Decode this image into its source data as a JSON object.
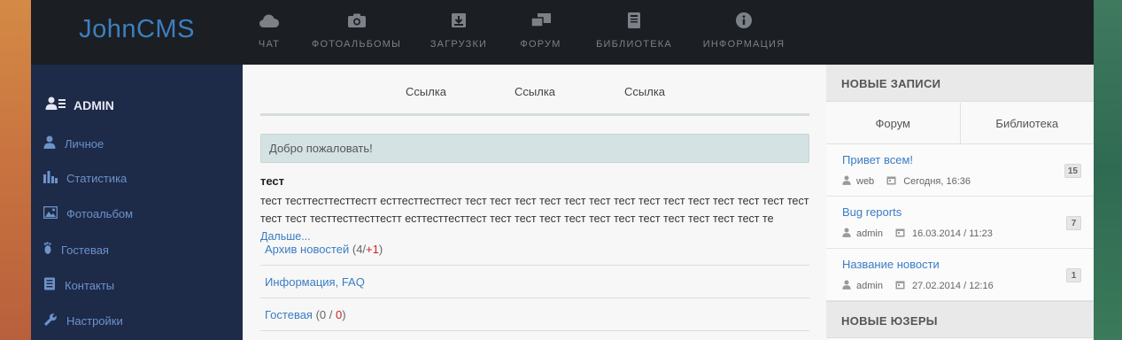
{
  "brand": "JohnCMS",
  "nav": [
    {
      "label": "ЧАТ",
      "icon": "cloud-icon"
    },
    {
      "label": "ФОТОАЛЬБОМЫ",
      "icon": "camera-icon"
    },
    {
      "label": "ЗАГРУЗКИ",
      "icon": "download-icon"
    },
    {
      "label": "ФОРУМ",
      "icon": "comments-icon"
    },
    {
      "label": "БИБЛИОТЕКА",
      "icon": "book-icon"
    },
    {
      "label": "ИНФОРМАЦИЯ",
      "icon": "info-icon"
    }
  ],
  "sidebar": {
    "user": "ADMIN",
    "items": [
      {
        "label": "Личное",
        "icon": "user-icon"
      },
      {
        "label": "Статистика",
        "icon": "bar-chart-icon"
      },
      {
        "label": "Фотоальбом",
        "icon": "picture-icon"
      },
      {
        "label": "Гостевая",
        "icon": "footprint-icon"
      },
      {
        "label": "Контакты",
        "icon": "contacts-icon"
      },
      {
        "label": "Настройки",
        "icon": "wrench-icon"
      }
    ]
  },
  "main": {
    "links": [
      "Ссылка",
      "Ссылка",
      "Ссылка"
    ],
    "welcome": "Добро пожаловать!",
    "news": {
      "title": "тест",
      "body": "тест тесттесттесттестт ecттесттесттест тест тест тест тест тест тест тест тест тест тест тест тест тест тест тест тест тесттесттесттестт ecттесттесттест тест тест тест тест тест тест тест тест тест тест тест те",
      "more": "Дальше..."
    },
    "list": [
      {
        "title": "Архив новостей",
        "open": " (",
        "count": "4",
        "sep": "/",
        "extra": "+1",
        "close": ")"
      },
      {
        "title": "Информация, FAQ",
        "open": "",
        "count": "",
        "sep": "",
        "extra": "",
        "close": ""
      },
      {
        "title": "Гостевая",
        "open": " (",
        "count": "0",
        "sep": " / ",
        "extra": "0",
        "close": ")"
      }
    ]
  },
  "right": {
    "header": "НОВЫЕ ЗАПИСИ",
    "tabs": [
      "Форум",
      "Библиотека"
    ],
    "items": [
      {
        "title": "Привет всем!",
        "user": "web",
        "date": "Сегодня, 16:36",
        "count": "15"
      },
      {
        "title": "Bug reports",
        "user": "admin",
        "date": "16.03.2014 / 11:23",
        "count": "7"
      },
      {
        "title": "Название новости",
        "user": "admin",
        "date": "27.02.2014 / 12:16",
        "count": "1"
      }
    ],
    "header2": "НОВЫЕ ЮЗЕРЫ"
  },
  "colors": {
    "topbar": "#1b1e22",
    "sidebar": "#1d2a48",
    "brand": "#3d7fc0",
    "link": "#3a7dc3",
    "accent_red": "#cc2222"
  }
}
